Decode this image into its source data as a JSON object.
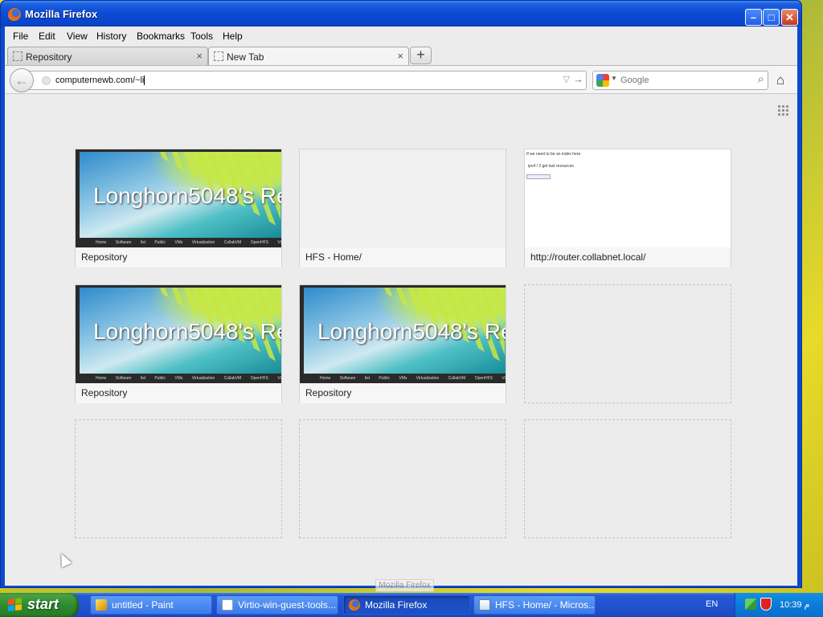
{
  "window": {
    "title": "Mozilla Firefox",
    "minimize": "–",
    "maximize": "□",
    "close": "✕"
  },
  "menu": {
    "items": [
      {
        "label": "File"
      },
      {
        "label": "Edit"
      },
      {
        "label": "View"
      },
      {
        "label": "History"
      },
      {
        "label": "Bookmarks"
      },
      {
        "label": "Tools"
      },
      {
        "label": "Help"
      }
    ]
  },
  "tabs": [
    {
      "label": "Repository",
      "close": "×",
      "active": false
    },
    {
      "label": "New Tab",
      "close": "×",
      "active": true
    }
  ],
  "new_tab_button": "+",
  "navbar": {
    "back": "←",
    "url": "computernewb.com/~li",
    "url_dropdown": "▽",
    "go": "→",
    "search_placeholder": "Google",
    "search_icon": "⌕",
    "home": "⌂"
  },
  "newtab": {
    "grid_toggle_icon": "grid-icon",
    "tiles": [
      {
        "caption": "Repository",
        "thumb": "longhorn"
      },
      {
        "caption": "HFS - Home/",
        "thumb": "blank"
      },
      {
        "caption": "http://router.collabnet.local/",
        "thumb": "doc"
      },
      {
        "caption": "Repository",
        "thumb": "longhorn"
      },
      {
        "caption": "Repository",
        "thumb": "longhorn"
      },
      {
        "caption": "",
        "thumb": "empty"
      },
      {
        "caption": "",
        "thumb": "empty"
      },
      {
        "caption": "",
        "thumb": "empty"
      },
      {
        "caption": "",
        "thumb": "empty"
      }
    ],
    "longhorn_thumb": {
      "title": "Longhorn5048's Re",
      "nav": "Home Software list Public VMs Virtualization CollabVM OpenHFS Viewmore"
    },
    "doc_thumb": {
      "line1": "If we need to be an index here",
      "line2": "ipv4 / 2 get last resources"
    }
  },
  "tooltip": "Mozilla Firefox",
  "taskbar": {
    "start": "start",
    "tasks": [
      {
        "label": "untitled - Paint",
        "active": false
      },
      {
        "label": "Virtio-win-guest-tools...",
        "active": false
      },
      {
        "label": "Mozilla Firefox",
        "active": true
      },
      {
        "label": "HFS - Home/ - Micros...",
        "active": false
      }
    ],
    "language": "EN",
    "clock": "10:39 م"
  },
  "colors": {
    "title_bar": "#0b4ad4",
    "taskbar": "#2352d0",
    "start_button": "#2e8b2e",
    "tray": "#0c7ad8",
    "newtab_background": "#ececec"
  }
}
